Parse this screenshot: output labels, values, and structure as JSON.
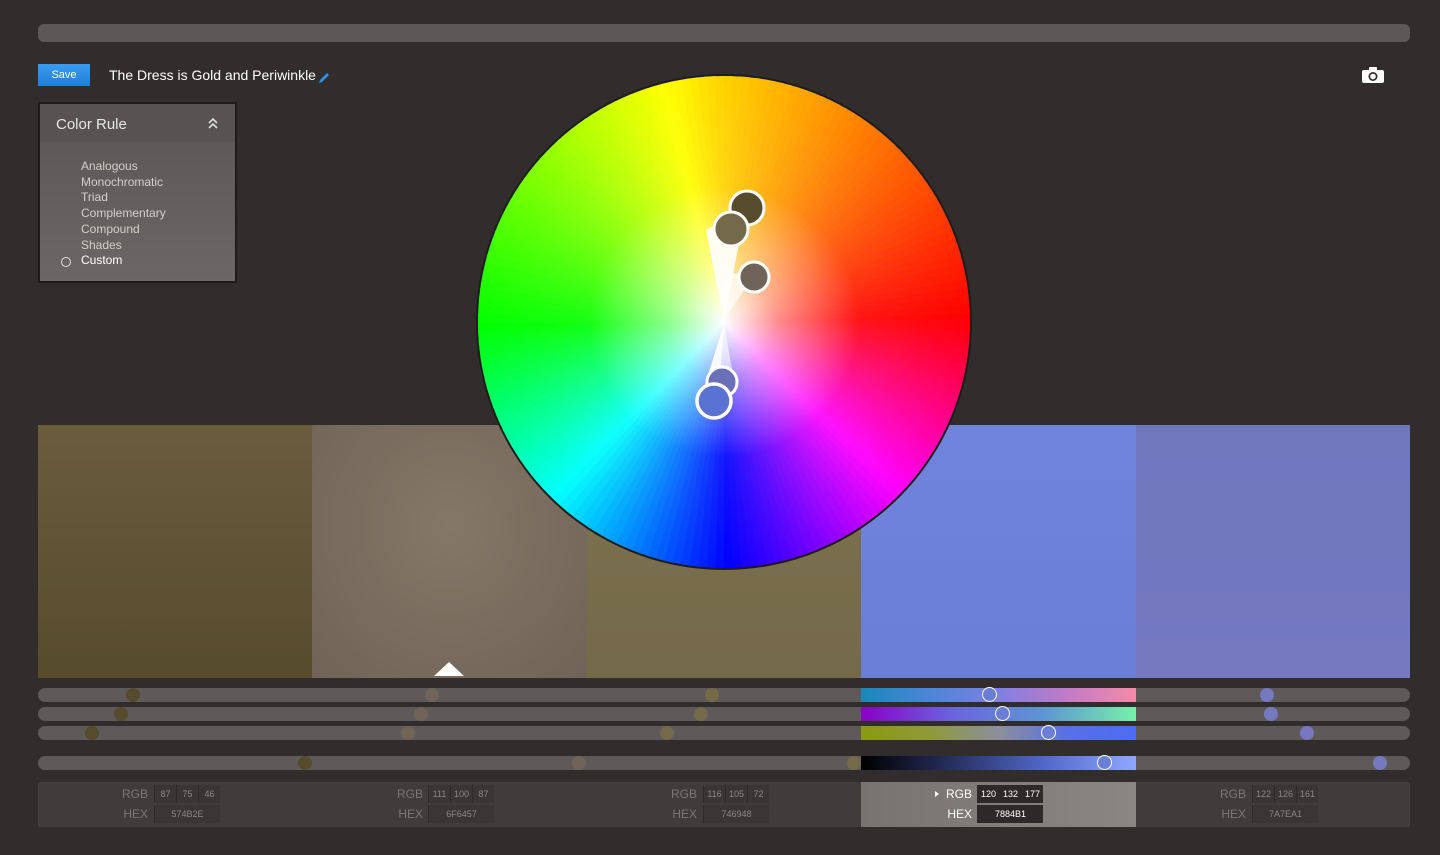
{
  "header": {
    "save_label": "Save",
    "theme_title": "The Dress is Gold and Periwinkle"
  },
  "color_rule": {
    "title": "Color Rule",
    "options": [
      "Analogous",
      "Monochromatic",
      "Triad",
      "Complementary",
      "Compound",
      "Shades",
      "Custom"
    ],
    "selected": "Custom"
  },
  "swatches": [
    {
      "hex_label": "574B2E",
      "r": "87",
      "g": "75",
      "b": "46",
      "color": "#574B2E"
    },
    {
      "hex_label": "6F6457",
      "r": "111",
      "g": "100",
      "b": "87",
      "color": "#6F6457"
    },
    {
      "hex_label": "746948",
      "r": "116",
      "g": "105",
      "b": "72",
      "color": "#746948"
    },
    {
      "hex_label": "7884B1",
      "r": "120",
      "g": "132",
      "b": "177",
      "color": "#6A7ED6"
    },
    {
      "hex_label": "7A7EA1",
      "r": "122",
      "g": "126",
      "b": "161",
      "color": "#7479C0"
    }
  ],
  "selected_swatch_index": 3,
  "labels": {
    "rgb": "RGB",
    "hex": "HEX"
  },
  "colors": {
    "background": "#312d2c",
    "accent": "#1f7fd8"
  },
  "icons": [
    "edit-icon",
    "camera-icon",
    "chevron-up-icon",
    "radio-icon",
    "pointer-icon",
    "caret-icon"
  ]
}
